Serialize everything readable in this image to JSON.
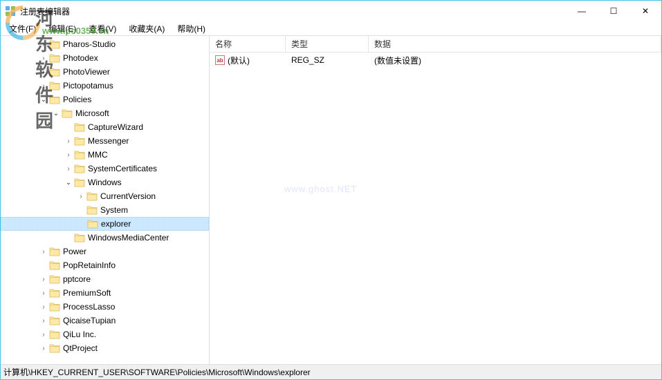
{
  "window": {
    "title": "注册表编辑器",
    "controls": {
      "minimize": "—",
      "maximize": "☐",
      "close": "✕"
    }
  },
  "menu": {
    "file": "文件(F)",
    "edit": "编辑(E)",
    "view": "查看(V)",
    "favorites": "收藏夹(A)",
    "help": "帮助(H)"
  },
  "watermark": {
    "text": "河东软件园",
    "url": "www.pc0359.cn",
    "center": "www.ghost.NET"
  },
  "list": {
    "columns": {
      "name": "名称",
      "type": "类型",
      "data": "数据"
    },
    "rows": [
      {
        "name": "(默认)",
        "type": "REG_SZ",
        "data": "(数值未设置)"
      }
    ]
  },
  "tree": {
    "indent_unit": 18,
    "nodes": [
      {
        "depth": 3,
        "exp": ">",
        "label": "Pharos-Studio"
      },
      {
        "depth": 3,
        "exp": ">",
        "label": "Photodex"
      },
      {
        "depth": 3,
        "exp": ">",
        "label": "PhotoViewer"
      },
      {
        "depth": 3,
        "exp": ">",
        "label": "Pictopotamus"
      },
      {
        "depth": 3,
        "exp": "v",
        "label": "Policies"
      },
      {
        "depth": 4,
        "exp": "v",
        "label": "Microsoft"
      },
      {
        "depth": 5,
        "exp": "",
        "label": "CaptureWizard"
      },
      {
        "depth": 5,
        "exp": ">",
        "label": "Messenger"
      },
      {
        "depth": 5,
        "exp": ">",
        "label": "MMC"
      },
      {
        "depth": 5,
        "exp": ">",
        "label": "SystemCertificates"
      },
      {
        "depth": 5,
        "exp": "v",
        "label": "Windows"
      },
      {
        "depth": 6,
        "exp": ">",
        "label": "CurrentVersion"
      },
      {
        "depth": 6,
        "exp": "",
        "label": "System"
      },
      {
        "depth": 6,
        "exp": "",
        "label": "explorer",
        "selected": true
      },
      {
        "depth": 5,
        "exp": "",
        "label": "WindowsMediaCenter"
      },
      {
        "depth": 3,
        "exp": ">",
        "label": "Power"
      },
      {
        "depth": 3,
        "exp": "",
        "label": "PopRetainInfo"
      },
      {
        "depth": 3,
        "exp": ">",
        "label": "pptcore"
      },
      {
        "depth": 3,
        "exp": ">",
        "label": "PremiumSoft"
      },
      {
        "depth": 3,
        "exp": ">",
        "label": "ProcessLasso"
      },
      {
        "depth": 3,
        "exp": ">",
        "label": "QicaiseTupian"
      },
      {
        "depth": 3,
        "exp": ">",
        "label": "QiLu Inc."
      },
      {
        "depth": 3,
        "exp": ">",
        "label": "QtProject"
      }
    ]
  },
  "statusbar": {
    "path": "计算机\\HKEY_CURRENT_USER\\SOFTWARE\\Policies\\Microsoft\\Windows\\explorer"
  }
}
